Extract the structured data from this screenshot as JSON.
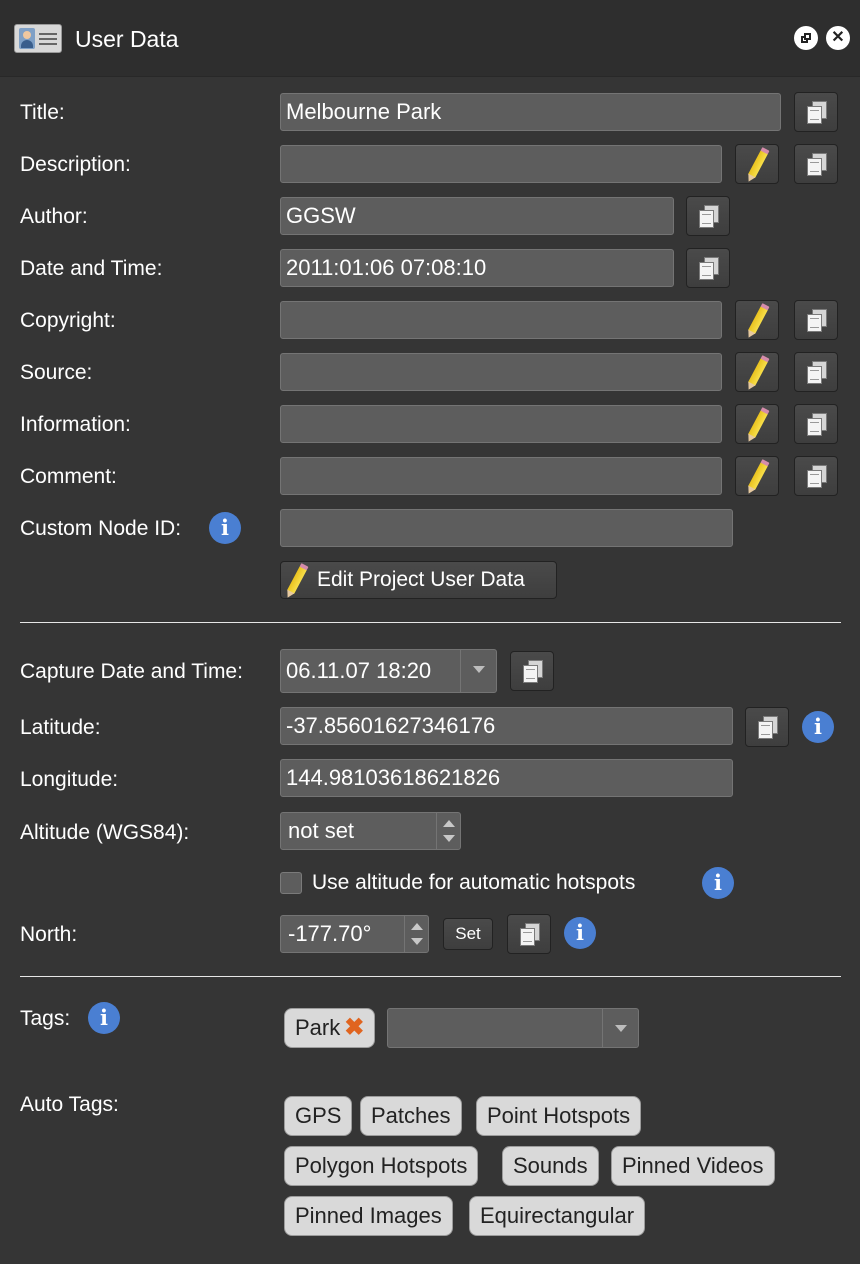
{
  "window": {
    "title": "User Data",
    "restore_icon": "restore-window-icon",
    "close_icon": "close-icon",
    "close_glyph": "✕"
  },
  "fields": [
    {
      "key": "title",
      "label": "Title:",
      "value": "Melbourne Park"
    },
    {
      "key": "description",
      "label": "Description:",
      "value": ""
    },
    {
      "key": "author",
      "label": "Author:",
      "value": "GGSW"
    },
    {
      "key": "datetime",
      "label": "Date and Time:",
      "value": "2011:01:06 07:08:10"
    },
    {
      "key": "copyright",
      "label": "Copyright:",
      "value": ""
    },
    {
      "key": "source",
      "label": "Source:",
      "value": ""
    },
    {
      "key": "information",
      "label": "Information:",
      "value": ""
    },
    {
      "key": "comment",
      "label": "Comment:",
      "value": ""
    },
    {
      "key": "custom_node_id",
      "label": "Custom Node ID:",
      "value": ""
    }
  ],
  "edit_project_button": "Edit Project User Data",
  "capture": {
    "label": "Capture Date and Time:",
    "value": "06.11.07 18:20"
  },
  "latitude": {
    "label": "Latitude:",
    "value": "-37.85601627346176"
  },
  "longitude": {
    "label": "Longitude:",
    "value": "144.98103618621826"
  },
  "altitude": {
    "label": "Altitude (WGS84):",
    "value": "not set"
  },
  "use_altitude": {
    "label": "Use altitude for automatic hotspots",
    "checked": false
  },
  "north": {
    "label": "North:",
    "value": "-177.70°",
    "set_button": "Set"
  },
  "tags": {
    "label": "Tags:",
    "items": [
      "Park"
    ],
    "remove_glyph": "✖",
    "dropdown_value": ""
  },
  "auto_tags": {
    "label": "Auto Tags:",
    "items": [
      "GPS",
      "Patches",
      "Point Hotspots",
      "Polygon Hotspots",
      "Sounds",
      "Pinned Videos",
      "Pinned Images",
      "Equirectangular"
    ]
  },
  "icons": {
    "info_glyph": "i"
  },
  "colors": {
    "background": "#353535",
    "field": "#5d5d5d",
    "info_blue": "#4a7fd2",
    "chip": "#d9d9d9",
    "tag_remove": "#e0641f",
    "pencil": "#f2cf2c"
  }
}
